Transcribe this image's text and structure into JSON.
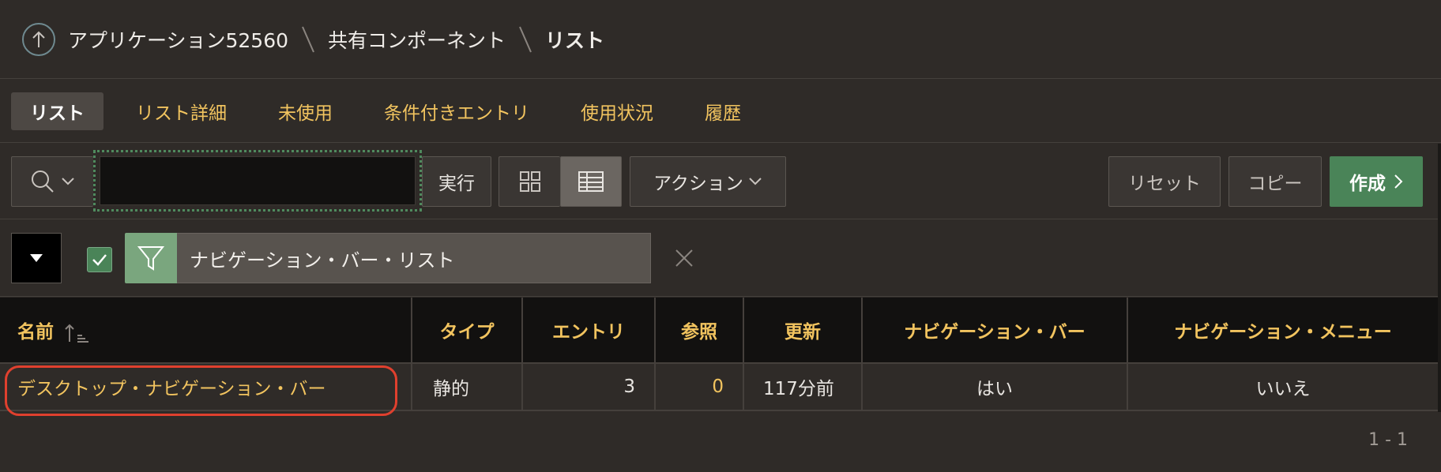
{
  "breadcrumb": {
    "items": [
      "アプリケーション52560",
      "共有コンポーネント",
      "リスト"
    ]
  },
  "tabs": [
    "リスト",
    "リスト詳細",
    "未使用",
    "条件付きエントリ",
    "使用状況",
    "履歴"
  ],
  "toolbar": {
    "search_value": "",
    "go_label": "実行",
    "actions_label": "アクション",
    "reset_label": "リセット",
    "copy_label": "コピー",
    "create_label": "作成"
  },
  "filter": {
    "label": "ナビゲーション・バー・リスト",
    "checked": true
  },
  "table": {
    "headers": [
      "名前",
      "タイプ",
      "エントリ",
      "参照",
      "更新",
      "ナビゲーション・バー",
      "ナビゲーション・メニュー"
    ],
    "rows": [
      [
        "デスクトップ・ナビゲーション・バー",
        "静的",
        "3",
        "0",
        "117分前",
        "はい",
        "いいえ"
      ]
    ]
  },
  "pagination": "1 - 1",
  "colors": {
    "accent": "#f2c45f",
    "create_button": "#4a8458",
    "background": "#2f2b28"
  }
}
